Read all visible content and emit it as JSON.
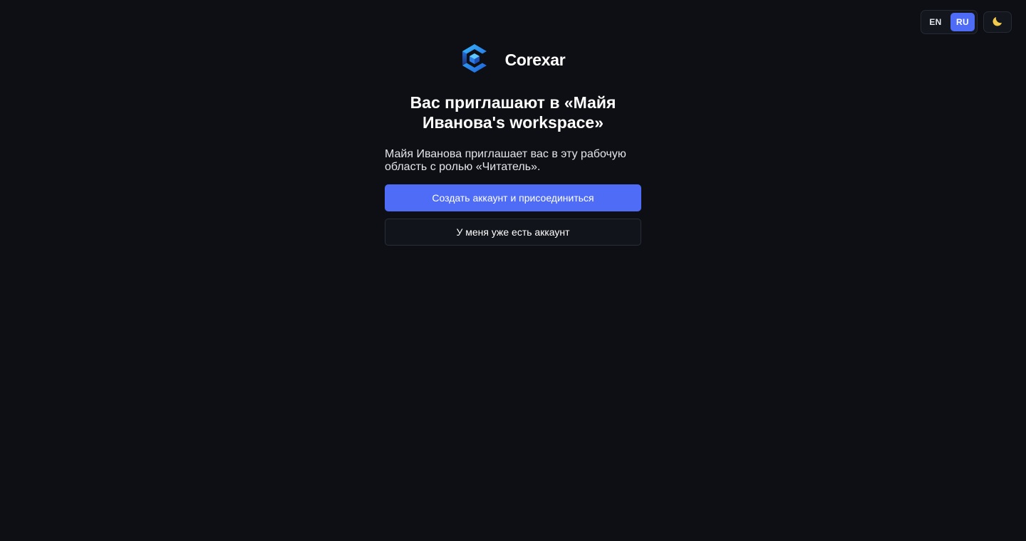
{
  "language_switch": {
    "options": [
      "EN",
      "RU"
    ],
    "selected": "RU"
  },
  "theme_toggle": {
    "icon": "moon-icon"
  },
  "brand": {
    "name": "Corexar",
    "logo_icon": "corexar-logo-icon"
  },
  "invite": {
    "title": "Вас приглашают в «Майя Иванова's workspace»",
    "description": "Майя Иванова приглашает вас в эту рабочую область с ролью «Читатель».",
    "primary_label": "Создать аккаунт и присоединиться",
    "secondary_label": "У меня уже есть аккаунт"
  },
  "colors": {
    "background": "#0e0f14",
    "accent": "#4f6cf7"
  }
}
